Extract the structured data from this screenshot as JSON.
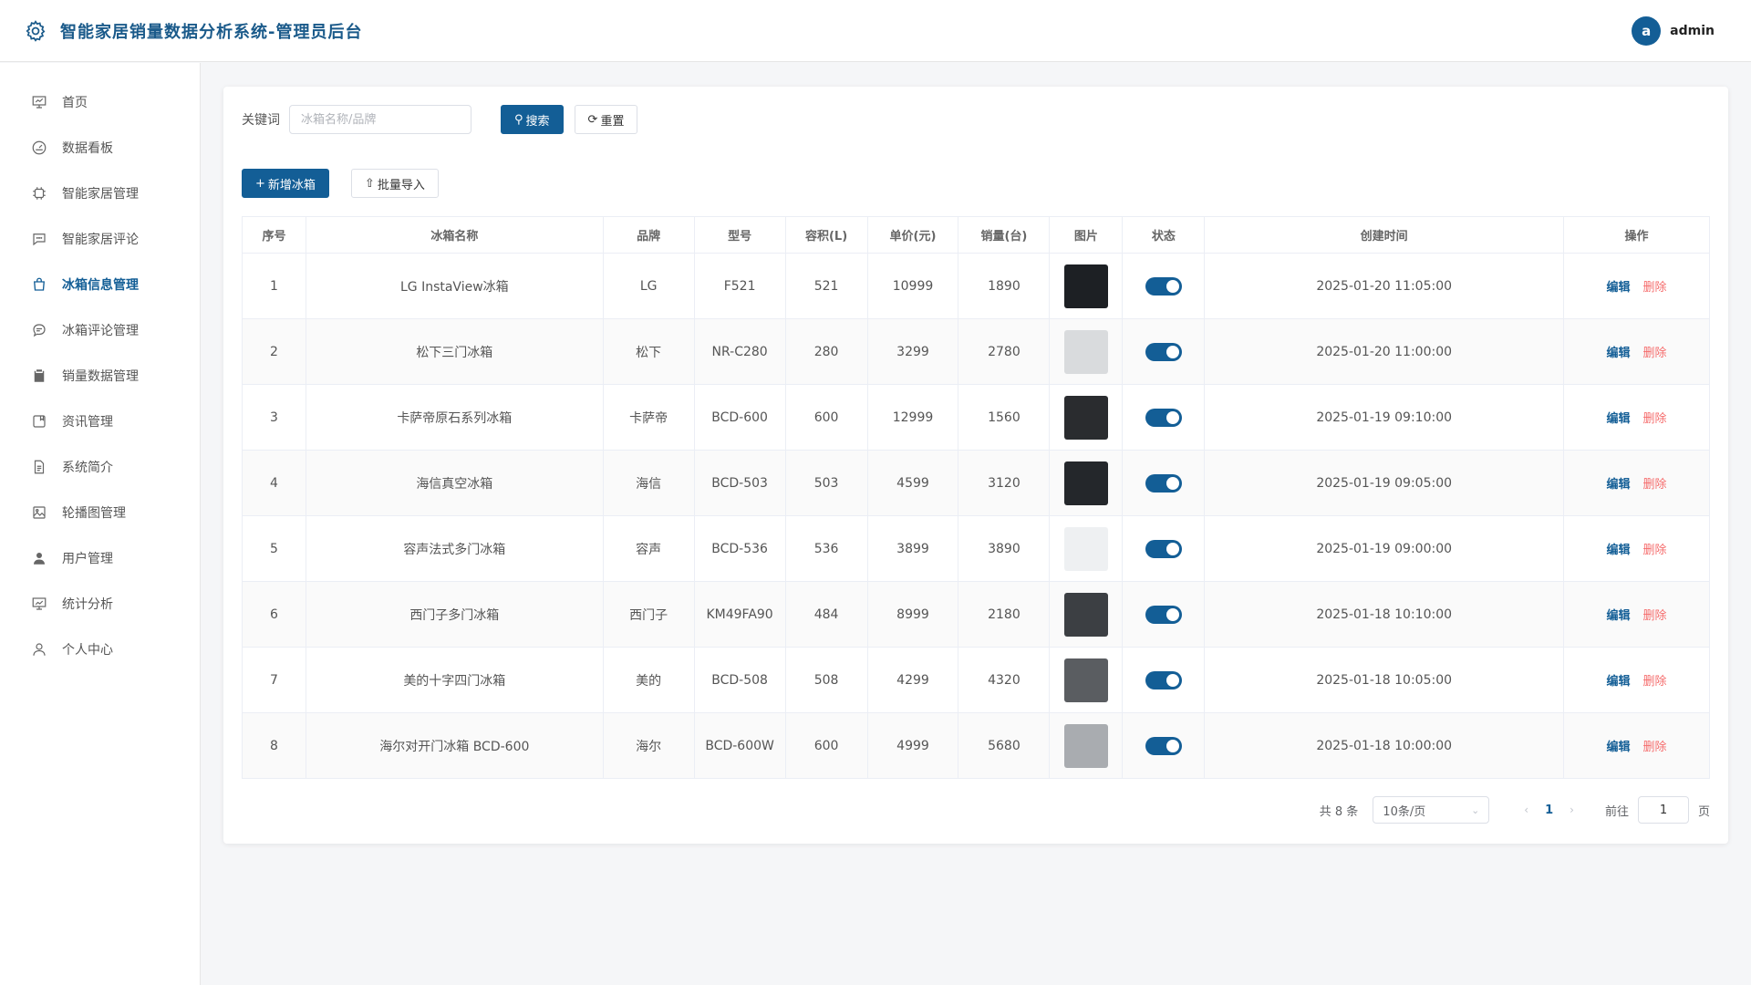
{
  "header": {
    "title": "智能家居销量数据分析系统-管理员后台",
    "avatar_letter": "a",
    "username": "admin"
  },
  "sidebar": {
    "items": [
      {
        "label": "首页",
        "icon": "presentation-icon"
      },
      {
        "label": "数据看板",
        "icon": "gauge-icon"
      },
      {
        "label": "智能家居管理",
        "icon": "chip-icon"
      },
      {
        "label": "智能家居评论",
        "icon": "chat-icon"
      },
      {
        "label": "冰箱信息管理",
        "icon": "bag-icon",
        "active": true
      },
      {
        "label": "冰箱评论管理",
        "icon": "comment-icon"
      },
      {
        "label": "销量数据管理",
        "icon": "clipboard-icon"
      },
      {
        "label": "资讯管理",
        "icon": "news-icon"
      },
      {
        "label": "系统简介",
        "icon": "document-icon"
      },
      {
        "label": "轮播图管理",
        "icon": "picture-icon"
      },
      {
        "label": "用户管理",
        "icon": "user-filled-icon"
      },
      {
        "label": "统计分析",
        "icon": "chart-board-icon"
      },
      {
        "label": "个人中心",
        "icon": "user-icon"
      }
    ]
  },
  "search": {
    "label": "关键词",
    "placeholder": "冰箱名称/品牌",
    "value": "",
    "search_btn": "搜索",
    "reset_btn": "重置"
  },
  "actions": {
    "add_btn": "新增冰箱",
    "import_btn": "批量导入"
  },
  "table": {
    "columns": [
      "序号",
      "冰箱名称",
      "品牌",
      "型号",
      "容积(L)",
      "单价(元)",
      "销量(台)",
      "图片",
      "状态",
      "创建时间",
      "操作"
    ],
    "edit_label": "编辑",
    "delete_label": "删除",
    "rows": [
      {
        "no": "1",
        "name": "LG InstaView冰箱",
        "brand": "LG",
        "model": "F521",
        "volume": "521",
        "price": "10999",
        "sales": "1890",
        "enabled": true,
        "created": "2025-01-20 11:05:00",
        "thumb_color": "#1d2024"
      },
      {
        "no": "2",
        "name": "松下三门冰箱",
        "brand": "松下",
        "model": "NR-C280",
        "volume": "280",
        "price": "3299",
        "sales": "2780",
        "enabled": true,
        "created": "2025-01-20 11:00:00",
        "thumb_color": "#d9dbdd"
      },
      {
        "no": "3",
        "name": "卡萨帝原石系列冰箱",
        "brand": "卡萨帝",
        "model": "BCD-600",
        "volume": "600",
        "price": "12999",
        "sales": "1560",
        "enabled": true,
        "created": "2025-01-19 09:10:00",
        "thumb_color": "#2a2c2f"
      },
      {
        "no": "4",
        "name": "海信真空冰箱",
        "brand": "海信",
        "model": "BCD-503",
        "volume": "503",
        "price": "4599",
        "sales": "3120",
        "enabled": true,
        "created": "2025-01-19 09:05:00",
        "thumb_color": "#24272b"
      },
      {
        "no": "5",
        "name": "容声法式多门冰箱",
        "brand": "容声",
        "model": "BCD-536",
        "volume": "536",
        "price": "3899",
        "sales": "3890",
        "enabled": true,
        "created": "2025-01-19 09:00:00",
        "thumb_color": "#eef0f2"
      },
      {
        "no": "6",
        "name": "西门子多门冰箱",
        "brand": "西门子",
        "model": "KM49FA90",
        "volume": "484",
        "price": "8999",
        "sales": "2180",
        "enabled": true,
        "created": "2025-01-18 10:10:00",
        "thumb_color": "#3c3f43"
      },
      {
        "no": "7",
        "name": "美的十字四门冰箱",
        "brand": "美的",
        "model": "BCD-508",
        "volume": "508",
        "price": "4299",
        "sales": "4320",
        "enabled": true,
        "created": "2025-01-18 10:05:00",
        "thumb_color": "#5a5d61"
      },
      {
        "no": "8",
        "name": "海尔对开门冰箱 BCD-600",
        "brand": "海尔",
        "model": "BCD-600W",
        "volume": "600",
        "price": "4999",
        "sales": "5680",
        "enabled": true,
        "created": "2025-01-18 10:00:00",
        "thumb_color": "#a9acb0"
      }
    ]
  },
  "pagination": {
    "total": "共 8 条",
    "page_size": "10条/页",
    "current": "1",
    "goto_label": "前往",
    "goto_value": "1",
    "page_suffix": "页"
  },
  "colors": {
    "primary": "#135e96",
    "danger": "#f56c6c"
  }
}
